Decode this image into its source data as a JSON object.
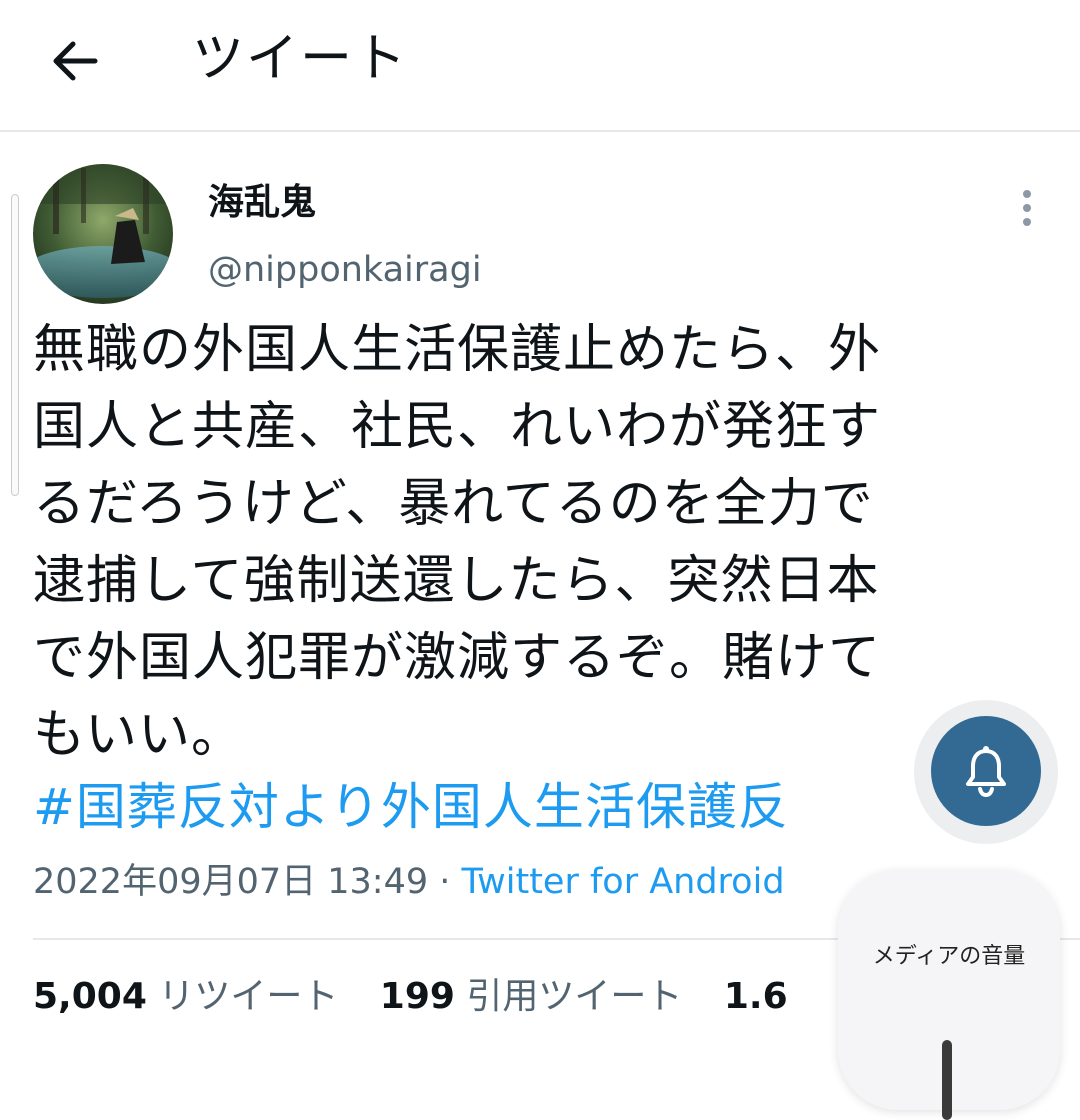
{
  "header": {
    "title": "ツイート",
    "back_icon": "arrow-left-icon"
  },
  "tweet": {
    "author": {
      "display_name": "海乱鬼",
      "handle": "@nipponkairagi"
    },
    "text": "無職の外国人生活保護止めたら、外\n国人と共産、社民、れいわが発狂す\nるだろうけど、暴れてるのを全力で\n逮捕して強制送還したら、突然日本\nで外国人犯罪が激減するぞ。賭けて\nもいい。",
    "hashtag": "#国葬反対より外国人生活保護反",
    "timestamp": "2022年09月07日 13:49",
    "separator": " · ",
    "source": "Twitter for Android",
    "stats": {
      "retweets": "5,004",
      "retweets_label": "リツイート",
      "quotes": "199",
      "quotes_label": "引用ツイート",
      "likes": "1.6"
    }
  },
  "overlays": {
    "notification_icon": "bell-icon",
    "volume_label": "メディアの音量"
  },
  "colors": {
    "accent": "#1d9bf0",
    "notify_button": "#336a93",
    "secondary_text": "#536471"
  }
}
